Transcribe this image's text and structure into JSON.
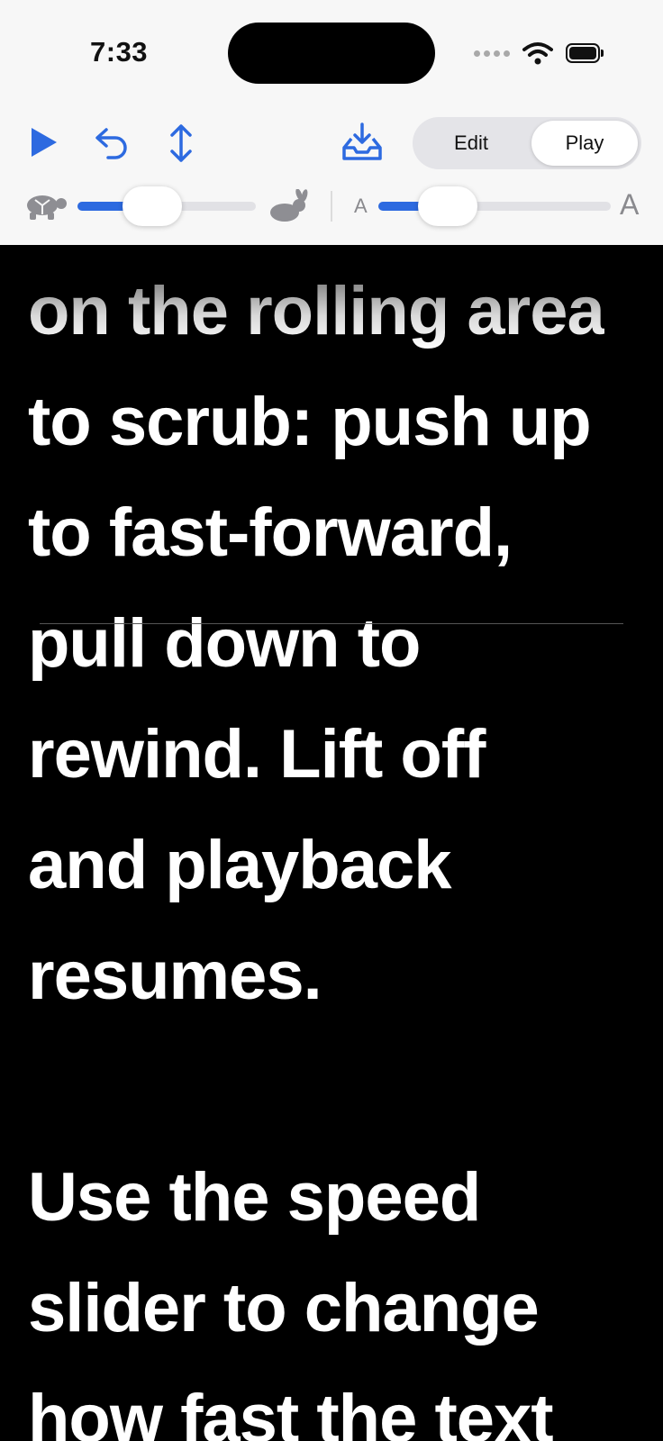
{
  "status_bar": {
    "time": "7:33"
  },
  "toolbar": {
    "mode_tabs": [
      {
        "label": "Edit",
        "selected": false
      },
      {
        "label": "Play",
        "selected": true
      }
    ],
    "speed_slider": {
      "value_fraction": 0.25,
      "min_icon": "turtle-icon",
      "max_icon": "rabbit-icon"
    },
    "font_slider": {
      "value_fraction": 0.17,
      "min_label": "A",
      "max_label": "A"
    },
    "accent_color": "#2d6ae0"
  },
  "reader": {
    "lines": [
      "on the rolling area",
      "to scrub: push up",
      "to fast-forward,",
      "pull down to",
      "rewind. Lift off",
      "and playback",
      "resumes.",
      "",
      "Use the speed",
      "slider to change",
      "how fast the text"
    ]
  }
}
